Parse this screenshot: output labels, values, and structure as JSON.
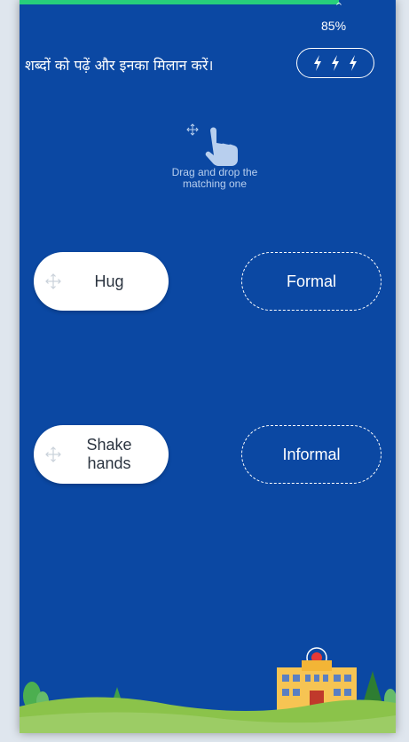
{
  "progress": {
    "percent_label": "85%",
    "caret": "^",
    "value": 0.85,
    "color": "#27cf7b"
  },
  "header": {
    "instruction": "शब्दों को पढ़ें और इनका मिलान करें।"
  },
  "hint": {
    "text": "Drag and drop the\nmatching one"
  },
  "drag_items": [
    {
      "label": "Hug"
    },
    {
      "label": "Shake\nhands"
    }
  ],
  "drop_targets": [
    {
      "label": "Formal"
    },
    {
      "label": "Informal"
    }
  ],
  "colors": {
    "background": "#0b48a3",
    "card": "#ffffff",
    "grass": "#8bc34a"
  },
  "icons": {
    "lives": "lightning-bolt-icon",
    "drag": "move-arrows-icon",
    "hint": "hand-pointer-icon"
  }
}
